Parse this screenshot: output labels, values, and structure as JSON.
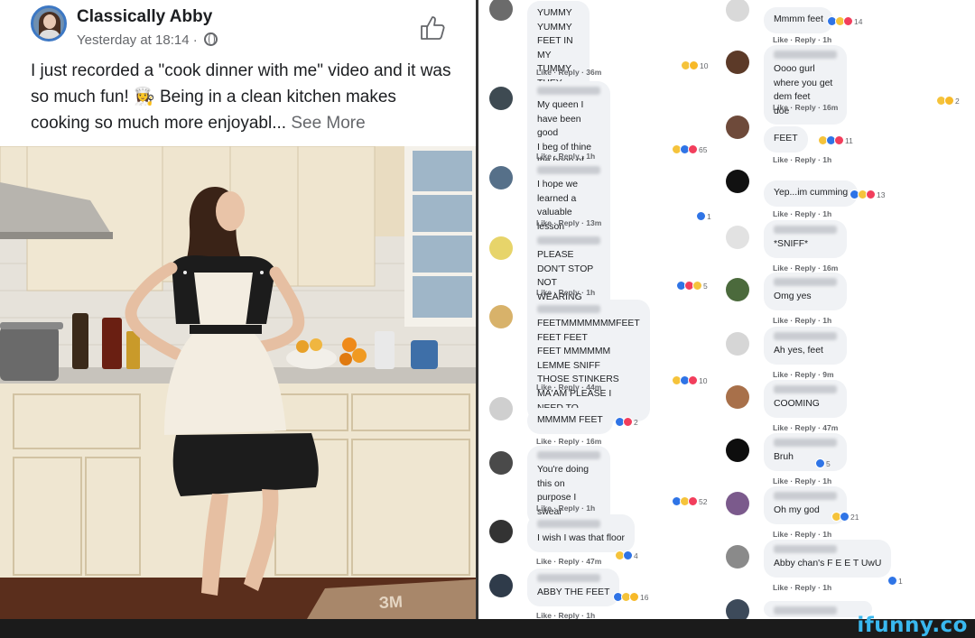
{
  "post": {
    "author": "Classically Abby",
    "timestamp": "Yesterday at 18:14 ·",
    "text": "I just recorded a \"cook dinner with me\" video and it was so much fun! 👩‍🍳 Being in a clean kitchen makes cooking so much more enjoyabl...",
    "see_more": "See More",
    "privacy_icon": "globe-icon",
    "like_icon": "thumbs-up-icon"
  },
  "watermark": "ifunny.co",
  "colors": {
    "facebook_blue": "#3d78c4",
    "comment_bubble": "#f0f2f5",
    "watermark": "#39b8ef"
  },
  "comments_left": [
    {
      "text": "YUMMY YUMMY FEET IN MY\nTUMMY\nTHEY GOT ME ACTIN COOCOO\nTHEY GOT MY DICKY CUMMIN",
      "meta": "Like · Reply · 36m",
      "count": "10"
    },
    {
      "text": "My queen I have been good\nI beg of thine the boon of just a\nsniff my lady",
      "meta": "Like · Reply · 1h",
      "count": "65"
    },
    {
      "text": "I hope we learned a valuable lesson\nabout cropping pictures today 😉",
      "meta": "Like · Reply · 13m",
      "count": "1"
    },
    {
      "text": "PLEASE DON'T STOP NOT WEARING\nSHOES",
      "meta": "Like · Reply · 1h",
      "count": "5"
    },
    {
      "text": "FEETMMMMMMMFEET FEET FEET\nFEET MMMMMM LEMME SNIFF\nTHOSE STINKERS MA'AM PLEASE I\nNEED TO",
      "meta": "Like · Reply · 44m",
      "count": "10"
    },
    {
      "text": "MMMMM FEET",
      "meta": "Like · Reply · 16m",
      "count": "2"
    },
    {
      "text": "You're doing this on purpose I\nswear",
      "meta": "Like · Reply · 1h",
      "count": "52"
    },
    {
      "text": "I wish I was that floor",
      "meta": "Like · Reply · 47m",
      "count": "4"
    },
    {
      "text": "ABBY THE FEET",
      "meta": "Like · Reply · 1h",
      "count": "16"
    }
  ],
  "comments_right": [
    {
      "text": "Mmmm feet",
      "meta": "Like · Reply · 1h",
      "count": "14"
    },
    {
      "text": "Oooo gurl where you get dem feet\ndoe",
      "meta": "Like · Reply · 16m",
      "count": "2"
    },
    {
      "text": "FEET",
      "meta": "Like · Reply · 1h",
      "count": "11"
    },
    {
      "text": "Yep...im cumming",
      "meta": "Like · Reply · 1h",
      "count": "13"
    },
    {
      "text": "*SNIFF*",
      "meta": "Like · Reply · 16m",
      "count": ""
    },
    {
      "text": "Omg yes",
      "meta": "Like · Reply · 1h",
      "count": ""
    },
    {
      "text": "Ah yes, feet",
      "meta": "Like · Reply · 9m",
      "count": ""
    },
    {
      "text": "COOMING",
      "meta": "Like · Reply · 47m",
      "count": ""
    },
    {
      "text": "Bruh",
      "meta": "Like · Reply · 1h",
      "count": "5"
    },
    {
      "text": "Oh my god",
      "meta": "Like · Reply · 1h",
      "count": "21"
    },
    {
      "text": "Abby chan's F E E T UwU",
      "meta": "Like · Reply · 1h",
      "count": "1"
    }
  ]
}
